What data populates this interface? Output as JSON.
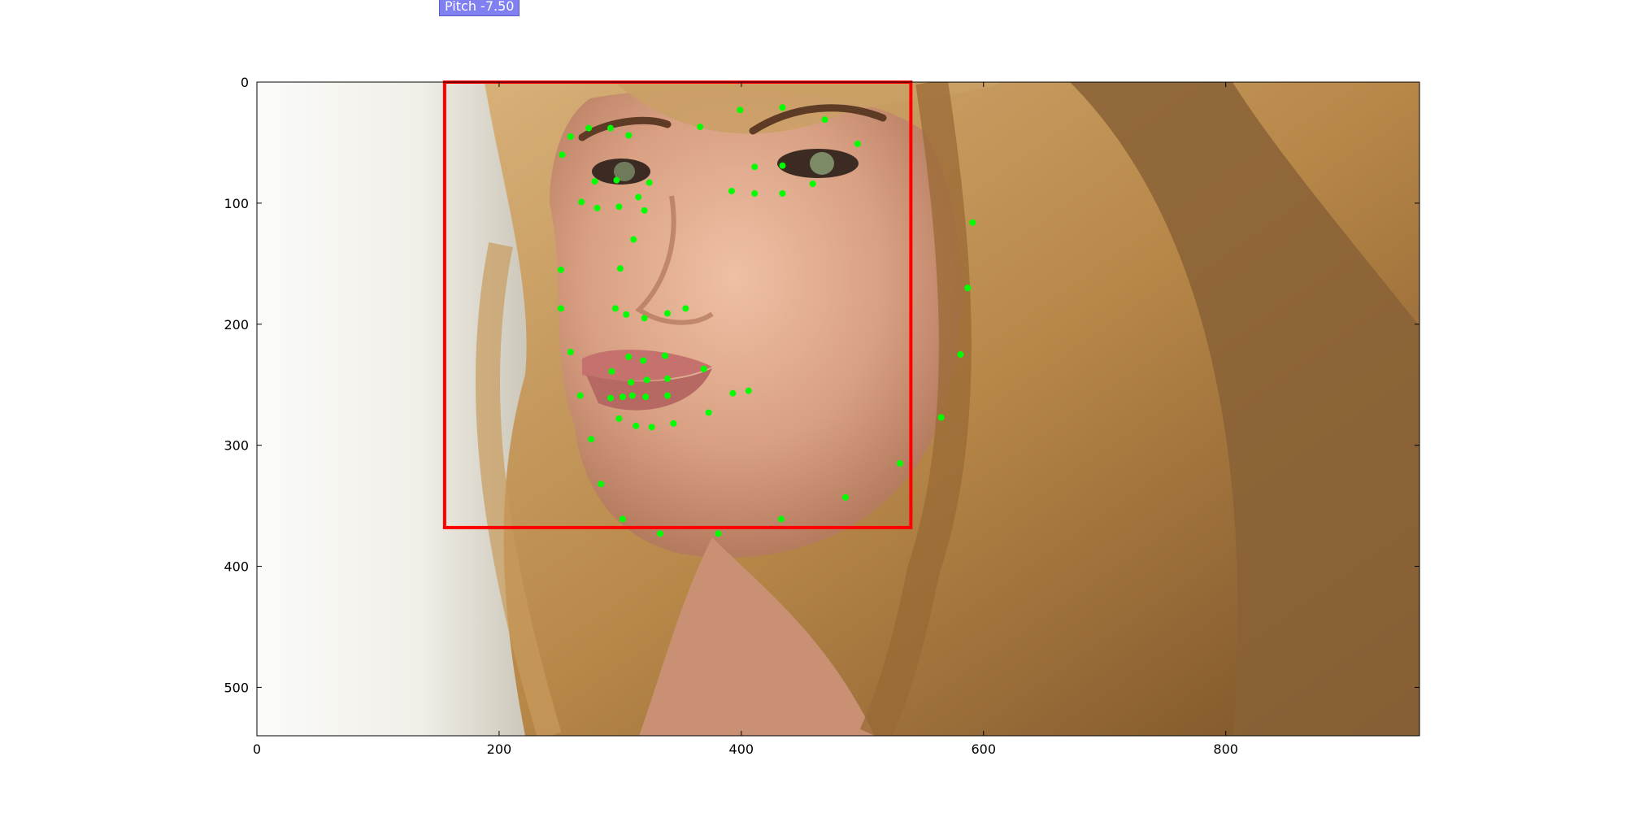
{
  "badge": {
    "label": "Pitch -7.50",
    "bg_color": "#8080f0"
  },
  "axes": {
    "x_ticks": [
      "0",
      "200",
      "400",
      "600",
      "800"
    ],
    "y_ticks": [
      "0",
      "100",
      "200",
      "300",
      "400",
      "500"
    ],
    "xlim": [
      0,
      960
    ],
    "ylim": [
      540,
      0
    ]
  },
  "bounding_box": {
    "x0": 155,
    "y0": 0,
    "x1": 540,
    "y1": 368,
    "color": "#ff0000"
  },
  "landmarks": {
    "color": "#00ff00",
    "points": [
      [
        252,
        60
      ],
      [
        259,
        45
      ],
      [
        274,
        38
      ],
      [
        292,
        38
      ],
      [
        307,
        44
      ],
      [
        366,
        37
      ],
      [
        399,
        23
      ],
      [
        434,
        21
      ],
      [
        469,
        31
      ],
      [
        496,
        51
      ],
      [
        279,
        82
      ],
      [
        297,
        81
      ],
      [
        324,
        83
      ],
      [
        299,
        103
      ],
      [
        281,
        104
      ],
      [
        268,
        99
      ],
      [
        411,
        70
      ],
      [
        434,
        69
      ],
      [
        459,
        84
      ],
      [
        434,
        92
      ],
      [
        411,
        92
      ],
      [
        392,
        90
      ],
      [
        315,
        95
      ],
      [
        320,
        106
      ],
      [
        311,
        130
      ],
      [
        300,
        154
      ],
      [
        251,
        155
      ],
      [
        251,
        187
      ],
      [
        259,
        223
      ],
      [
        267,
        259
      ],
      [
        276,
        295
      ],
      [
        284,
        332
      ],
      [
        302,
        361
      ],
      [
        333,
        373
      ],
      [
        381,
        373
      ],
      [
        296,
        187
      ],
      [
        305,
        192
      ],
      [
        320,
        195
      ],
      [
        339,
        191
      ],
      [
        354,
        187
      ],
      [
        293,
        239
      ],
      [
        307,
        227
      ],
      [
        319,
        230
      ],
      [
        337,
        226
      ],
      [
        369,
        237
      ],
      [
        406,
        255
      ],
      [
        292,
        261
      ],
      [
        302,
        260
      ],
      [
        310,
        259
      ],
      [
        321,
        260
      ],
      [
        339,
        259
      ],
      [
        393,
        257
      ],
      [
        299,
        278
      ],
      [
        313,
        284
      ],
      [
        326,
        285
      ],
      [
        344,
        282
      ],
      [
        373,
        273
      ],
      [
        309,
        248
      ],
      [
        322,
        246
      ],
      [
        339,
        245
      ],
      [
        591,
        116
      ],
      [
        587,
        170
      ],
      [
        581,
        225
      ],
      [
        565,
        277
      ],
      [
        531,
        315
      ],
      [
        486,
        343
      ],
      [
        433,
        361
      ]
    ]
  },
  "photo": {
    "skin_color": "#d8a286",
    "hair_color": "#b98a4c",
    "dark_hair_color": "#6b4526",
    "background_color": "#f3f1ec"
  }
}
